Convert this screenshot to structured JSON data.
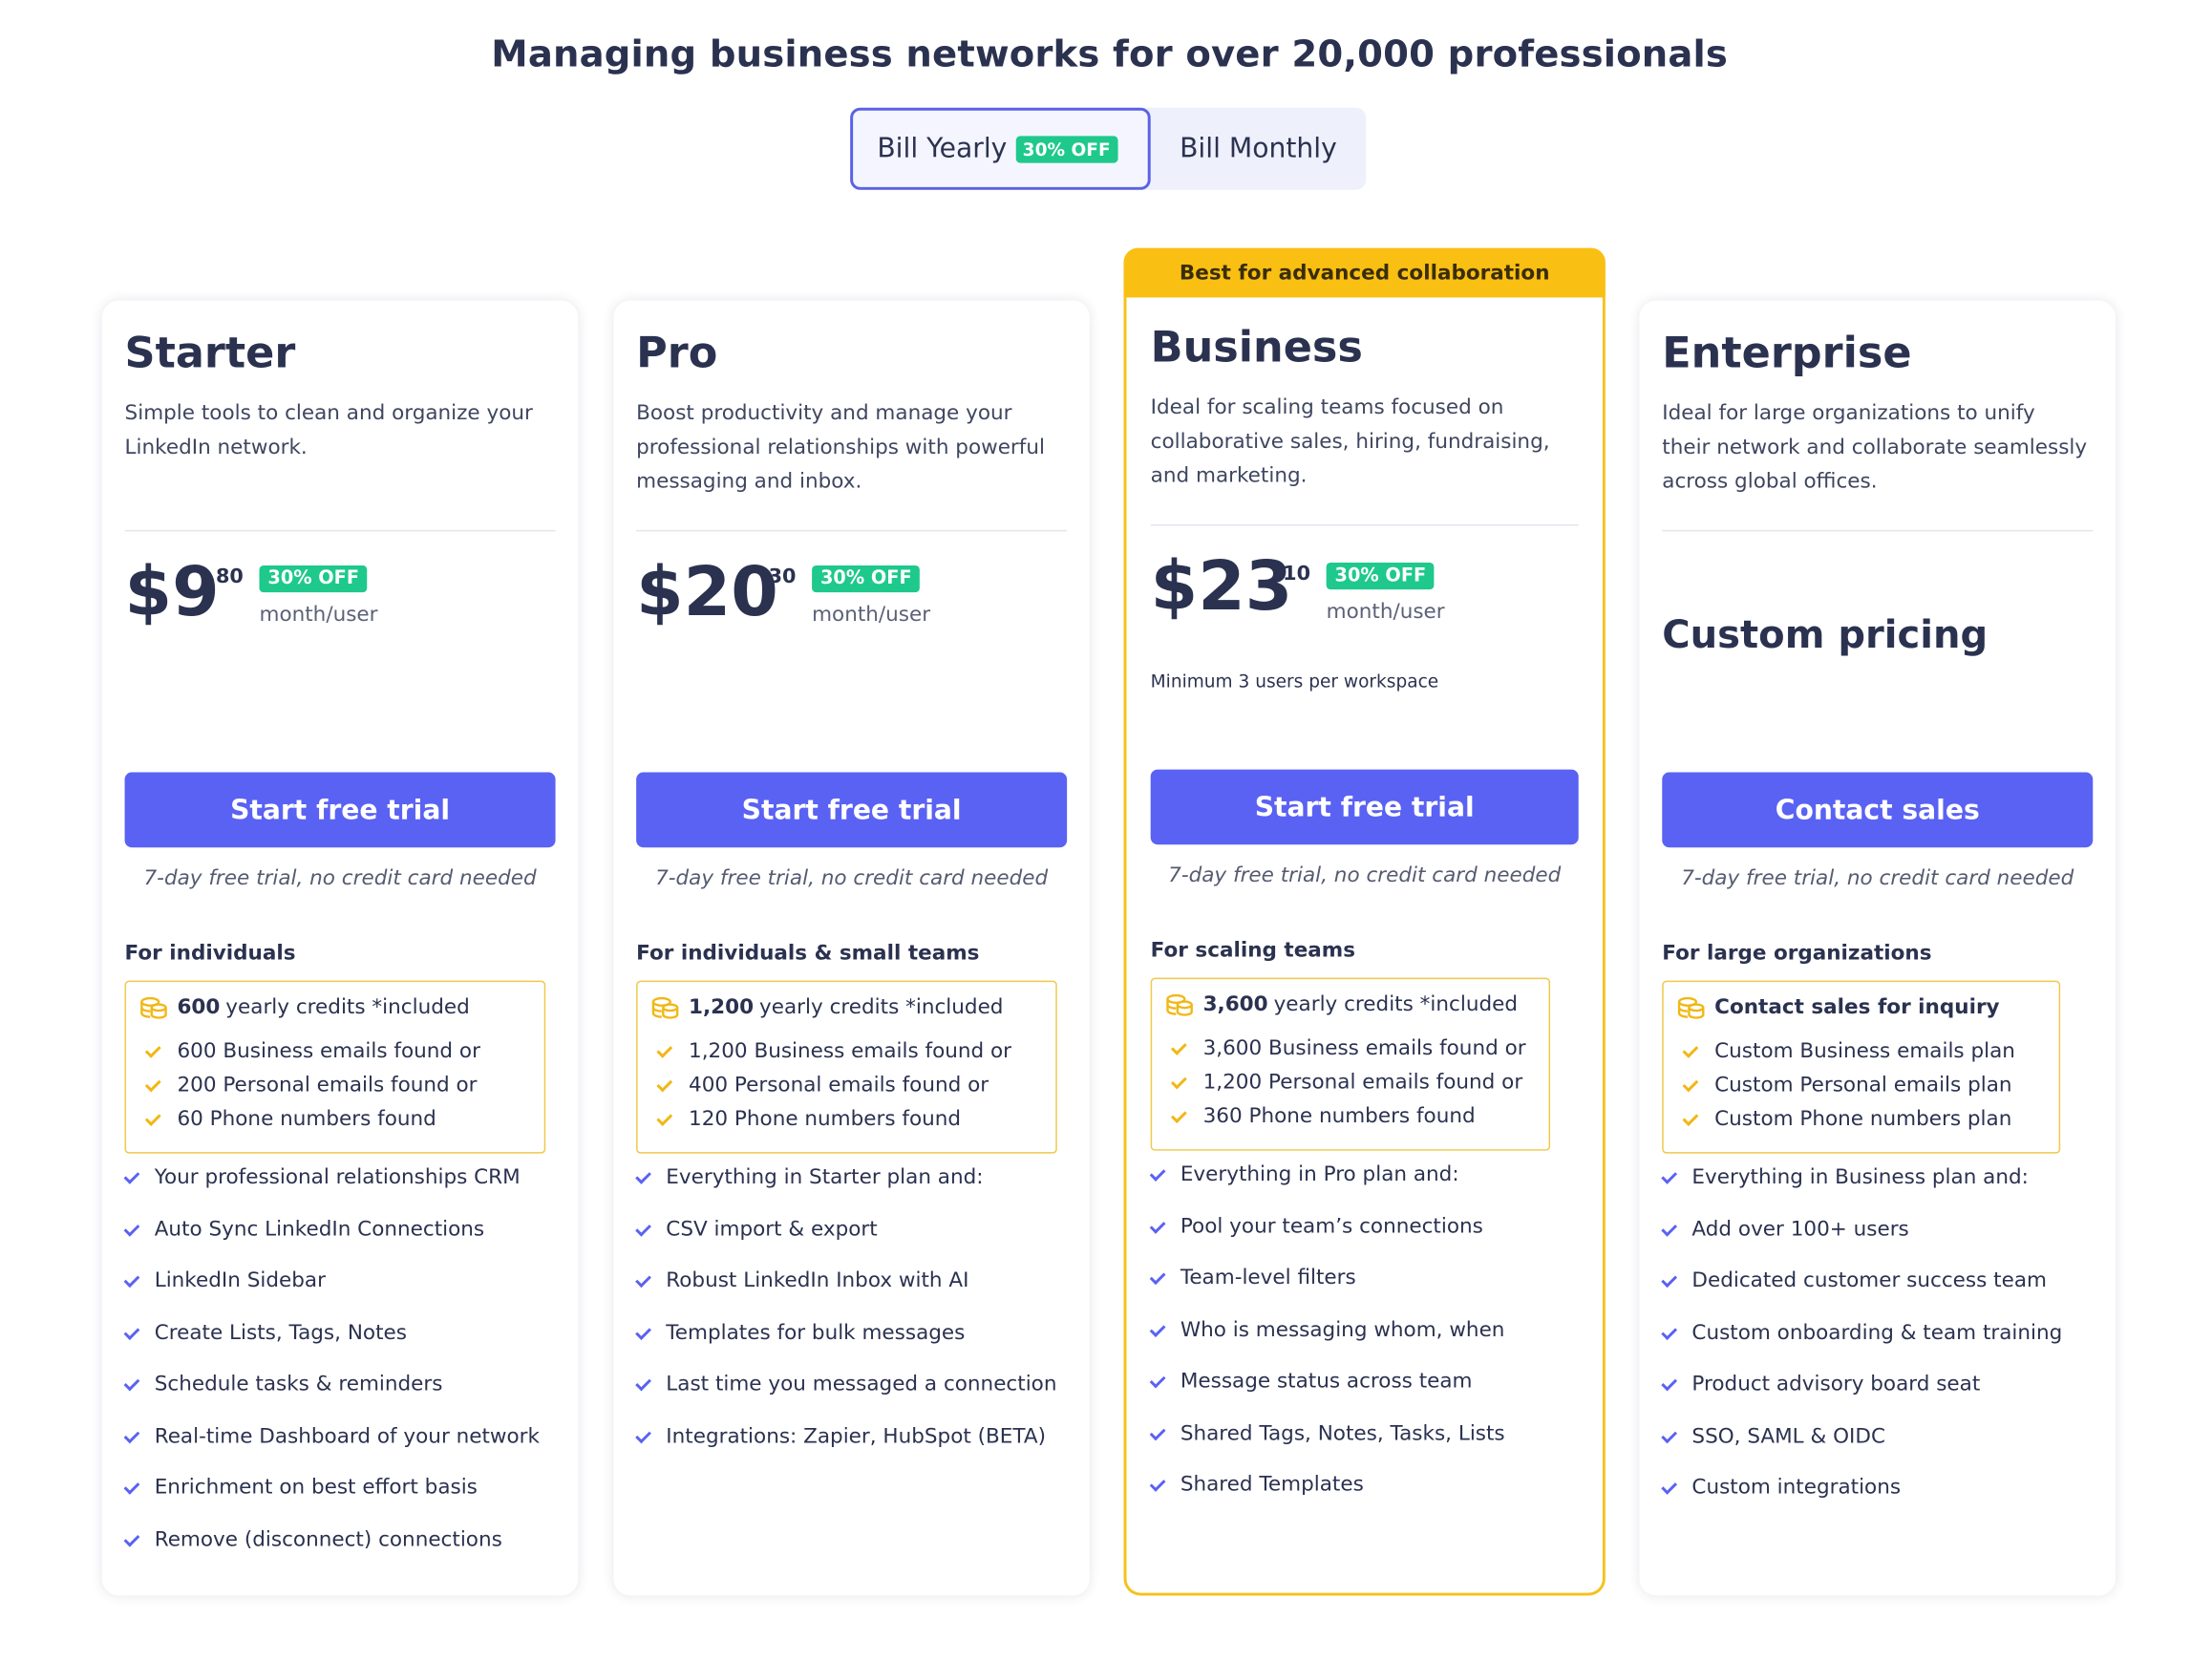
{
  "header": {
    "title": "Managing business networks for over 20,000 professionals"
  },
  "billing": {
    "yearly_label": "Bill Yearly",
    "yearly_badge": "30% OFF",
    "monthly_label": "Bill Monthly"
  },
  "colors": {
    "accent": "#5a62f3",
    "discount": "#1ec98b",
    "highlight": "#f9bf13",
    "text": "#2b3250"
  },
  "plans": [
    {
      "name": "Starter",
      "description": "Simple tools to clean and organize your LinkedIn network.",
      "price_dollar": "$9",
      "price_cents": ".80",
      "discount": "30% OFF",
      "price_unit": "month/user",
      "cta": "Start free trial",
      "trial_note": "7-day free trial, no credit card needed",
      "audience": "For individuals",
      "credits_bold": "600",
      "credits_text": "yearly credits *included",
      "credit_items": [
        "600 Business emails found or",
        "200 Personal emails found or",
        "60 Phone numbers found"
      ],
      "features": [
        "Your professional relationships CRM",
        "Auto Sync LinkedIn Connections",
        "LinkedIn Sidebar",
        "Create Lists, Tags, Notes",
        "Schedule tasks & reminders",
        "Real-time Dashboard of your network",
        "Enrichment on best effort basis",
        "Remove (disconnect) connections"
      ]
    },
    {
      "name": "Pro",
      "description": "Boost productivity and manage your professional relationships with powerful messaging and inbox.",
      "price_dollar": "$20",
      "price_cents": ".30",
      "discount": "30% OFF",
      "price_unit": "month/user",
      "cta": "Start free trial",
      "trial_note": "7-day free trial, no credit card needed",
      "audience": "For individuals & small teams",
      "credits_bold": "1,200",
      "credits_text": "yearly credits *included",
      "credit_items": [
        "1,200 Business emails found or",
        "400 Personal emails found or",
        "120 Phone numbers found"
      ],
      "features": [
        "Everything in Starter plan and:",
        "CSV import & export",
        "Robust LinkedIn Inbox with AI",
        "Templates for bulk messages",
        "Last time you messaged a connection",
        "Integrations: Zapier, HubSpot (BETA)"
      ]
    },
    {
      "banner": "Best for advanced collaboration",
      "name": "Business",
      "description": "Ideal for scaling teams focused on collaborative sales, hiring, fundraising, and marketing.",
      "price_dollar": "$23",
      "price_cents": ".10",
      "discount": "30% OFF",
      "price_unit": "month/user",
      "price_note": "Minimum 3 users per workspace",
      "cta": "Start free trial",
      "trial_note": "7-day free trial, no credit card needed",
      "audience": "For scaling teams",
      "credits_bold": "3,600",
      "credits_text": "yearly credits *included",
      "credit_items": [
        "3,600 Business emails found or",
        "1,200 Personal emails found or",
        "360 Phone numbers found"
      ],
      "features": [
        "Everything in Pro plan and:",
        "Pool your team’s connections",
        "Team-level filters",
        "Who is messaging whom, when",
        "Message status across team",
        "Shared Tags, Notes, Tasks, Lists",
        "Shared Templates"
      ]
    },
    {
      "name": "Enterprise",
      "description": "Ideal for large organizations to unify their network and collaborate seamlessly across global offices.",
      "custom_pricing": "Custom pricing",
      "cta": "Contact sales",
      "trial_note": "7-day free trial, no credit card needed",
      "audience": "For large organizations",
      "credits_bold": "Contact sales for inquiry",
      "credits_text": "",
      "credit_items": [
        "Custom Business emails plan",
        "Custom Personal emails plan",
        "Custom Phone numbers plan"
      ],
      "features": [
        "Everything in Business plan and:",
        "Add over 100+ users",
        "Dedicated customer success team",
        "Custom onboarding & team training",
        "Product advisory board seat",
        "SSO, SAML & OIDC",
        "Custom integrations"
      ]
    }
  ]
}
